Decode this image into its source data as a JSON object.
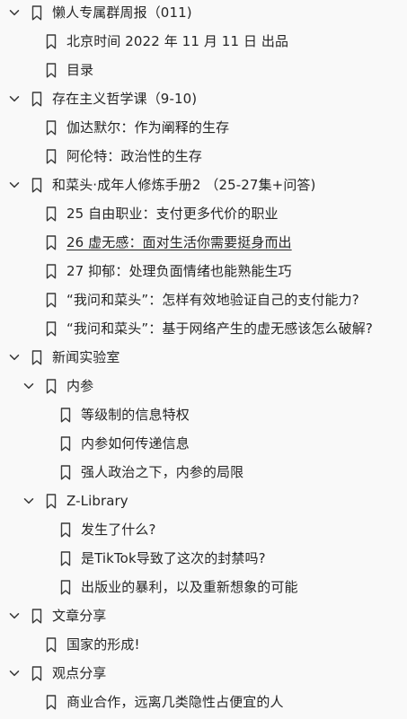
{
  "outline": [
    {
      "label": "懒人专属群周报（011)",
      "level": 0,
      "expandable": true,
      "expanded": true,
      "name": "outline-item-weekly-report"
    },
    {
      "label": "北京时间 2022 年 11 月 11 日 出品",
      "level": 1,
      "expandable": false,
      "name": "outline-item-beijing-time"
    },
    {
      "label": "目录",
      "level": 1,
      "expandable": false,
      "name": "outline-item-contents"
    },
    {
      "label": "存在主义哲学课（9-10)",
      "level": 0,
      "expandable": true,
      "expanded": true,
      "name": "outline-item-existentialism"
    },
    {
      "label": "伽达默尔：作为阐释的生存",
      "level": 1,
      "expandable": false,
      "name": "outline-item-gadamer"
    },
    {
      "label": "阿伦特：政治性的生存",
      "level": 1,
      "expandable": false,
      "name": "outline-item-arendt"
    },
    {
      "label": "和菜头·成年人修炼手册2 （25-27集+问答)",
      "level": 0,
      "expandable": true,
      "expanded": true,
      "name": "outline-item-hecaitou-handbook"
    },
    {
      "label": "25 自由职业：支付更多代价的职业",
      "level": 1,
      "expandable": false,
      "name": "outline-item-ep25"
    },
    {
      "label": "26 虚无感：面对生活你需要挺身而出",
      "level": 1,
      "expandable": false,
      "underline": true,
      "name": "outline-item-ep26"
    },
    {
      "label": "27 抑郁：处理负面情绪也能熟能生巧",
      "level": 1,
      "expandable": false,
      "name": "outline-item-ep27"
    },
    {
      "label": "“我问和菜头”：怎样有效地验证自己的支付能力?",
      "level": 1,
      "expandable": false,
      "name": "outline-item-qa-payment"
    },
    {
      "label": "“我问和菜头”：基于网络产生的虚无感该怎么破解?",
      "level": 1,
      "expandable": false,
      "name": "outline-item-qa-nihilism"
    },
    {
      "label": "新闻实验室",
      "level": 0,
      "expandable": true,
      "expanded": true,
      "name": "outline-item-news-lab"
    },
    {
      "label": "内参",
      "level": 1,
      "expandable": true,
      "expanded": true,
      "name": "outline-item-neican"
    },
    {
      "label": "等级制的信息特权",
      "level": 2,
      "expandable": false,
      "name": "outline-item-info-privilege"
    },
    {
      "label": "内参如何传递信息",
      "level": 2,
      "expandable": false,
      "name": "outline-item-neican-transfer"
    },
    {
      "label": "强人政治之下，内参的局限",
      "level": 2,
      "expandable": false,
      "name": "outline-item-neican-limits"
    },
    {
      "label": "Z-Library",
      "level": 1,
      "expandable": true,
      "expanded": true,
      "name": "outline-item-zlibrary"
    },
    {
      "label": "发生了什么?",
      "level": 2,
      "expandable": false,
      "name": "outline-item-what-happened"
    },
    {
      "label": "是TikTok导致了这次的封禁吗?",
      "level": 2,
      "expandable": false,
      "name": "outline-item-tiktok"
    },
    {
      "label": "出版业的暴利，以及重新想象的可能",
      "level": 2,
      "expandable": false,
      "name": "outline-item-publishing"
    },
    {
      "label": "文章分享",
      "level": 0,
      "expandable": true,
      "expanded": true,
      "name": "outline-item-articles"
    },
    {
      "label": "国家的形成!",
      "level": 1,
      "expandable": false,
      "name": "outline-item-state-formation"
    },
    {
      "label": "观点分享",
      "level": 0,
      "expandable": true,
      "expanded": true,
      "name": "outline-item-opinions"
    },
    {
      "label": "商业合作，远离几类隐性占便宜的人",
      "level": 1,
      "expandable": false,
      "name": "outline-item-business"
    }
  ]
}
